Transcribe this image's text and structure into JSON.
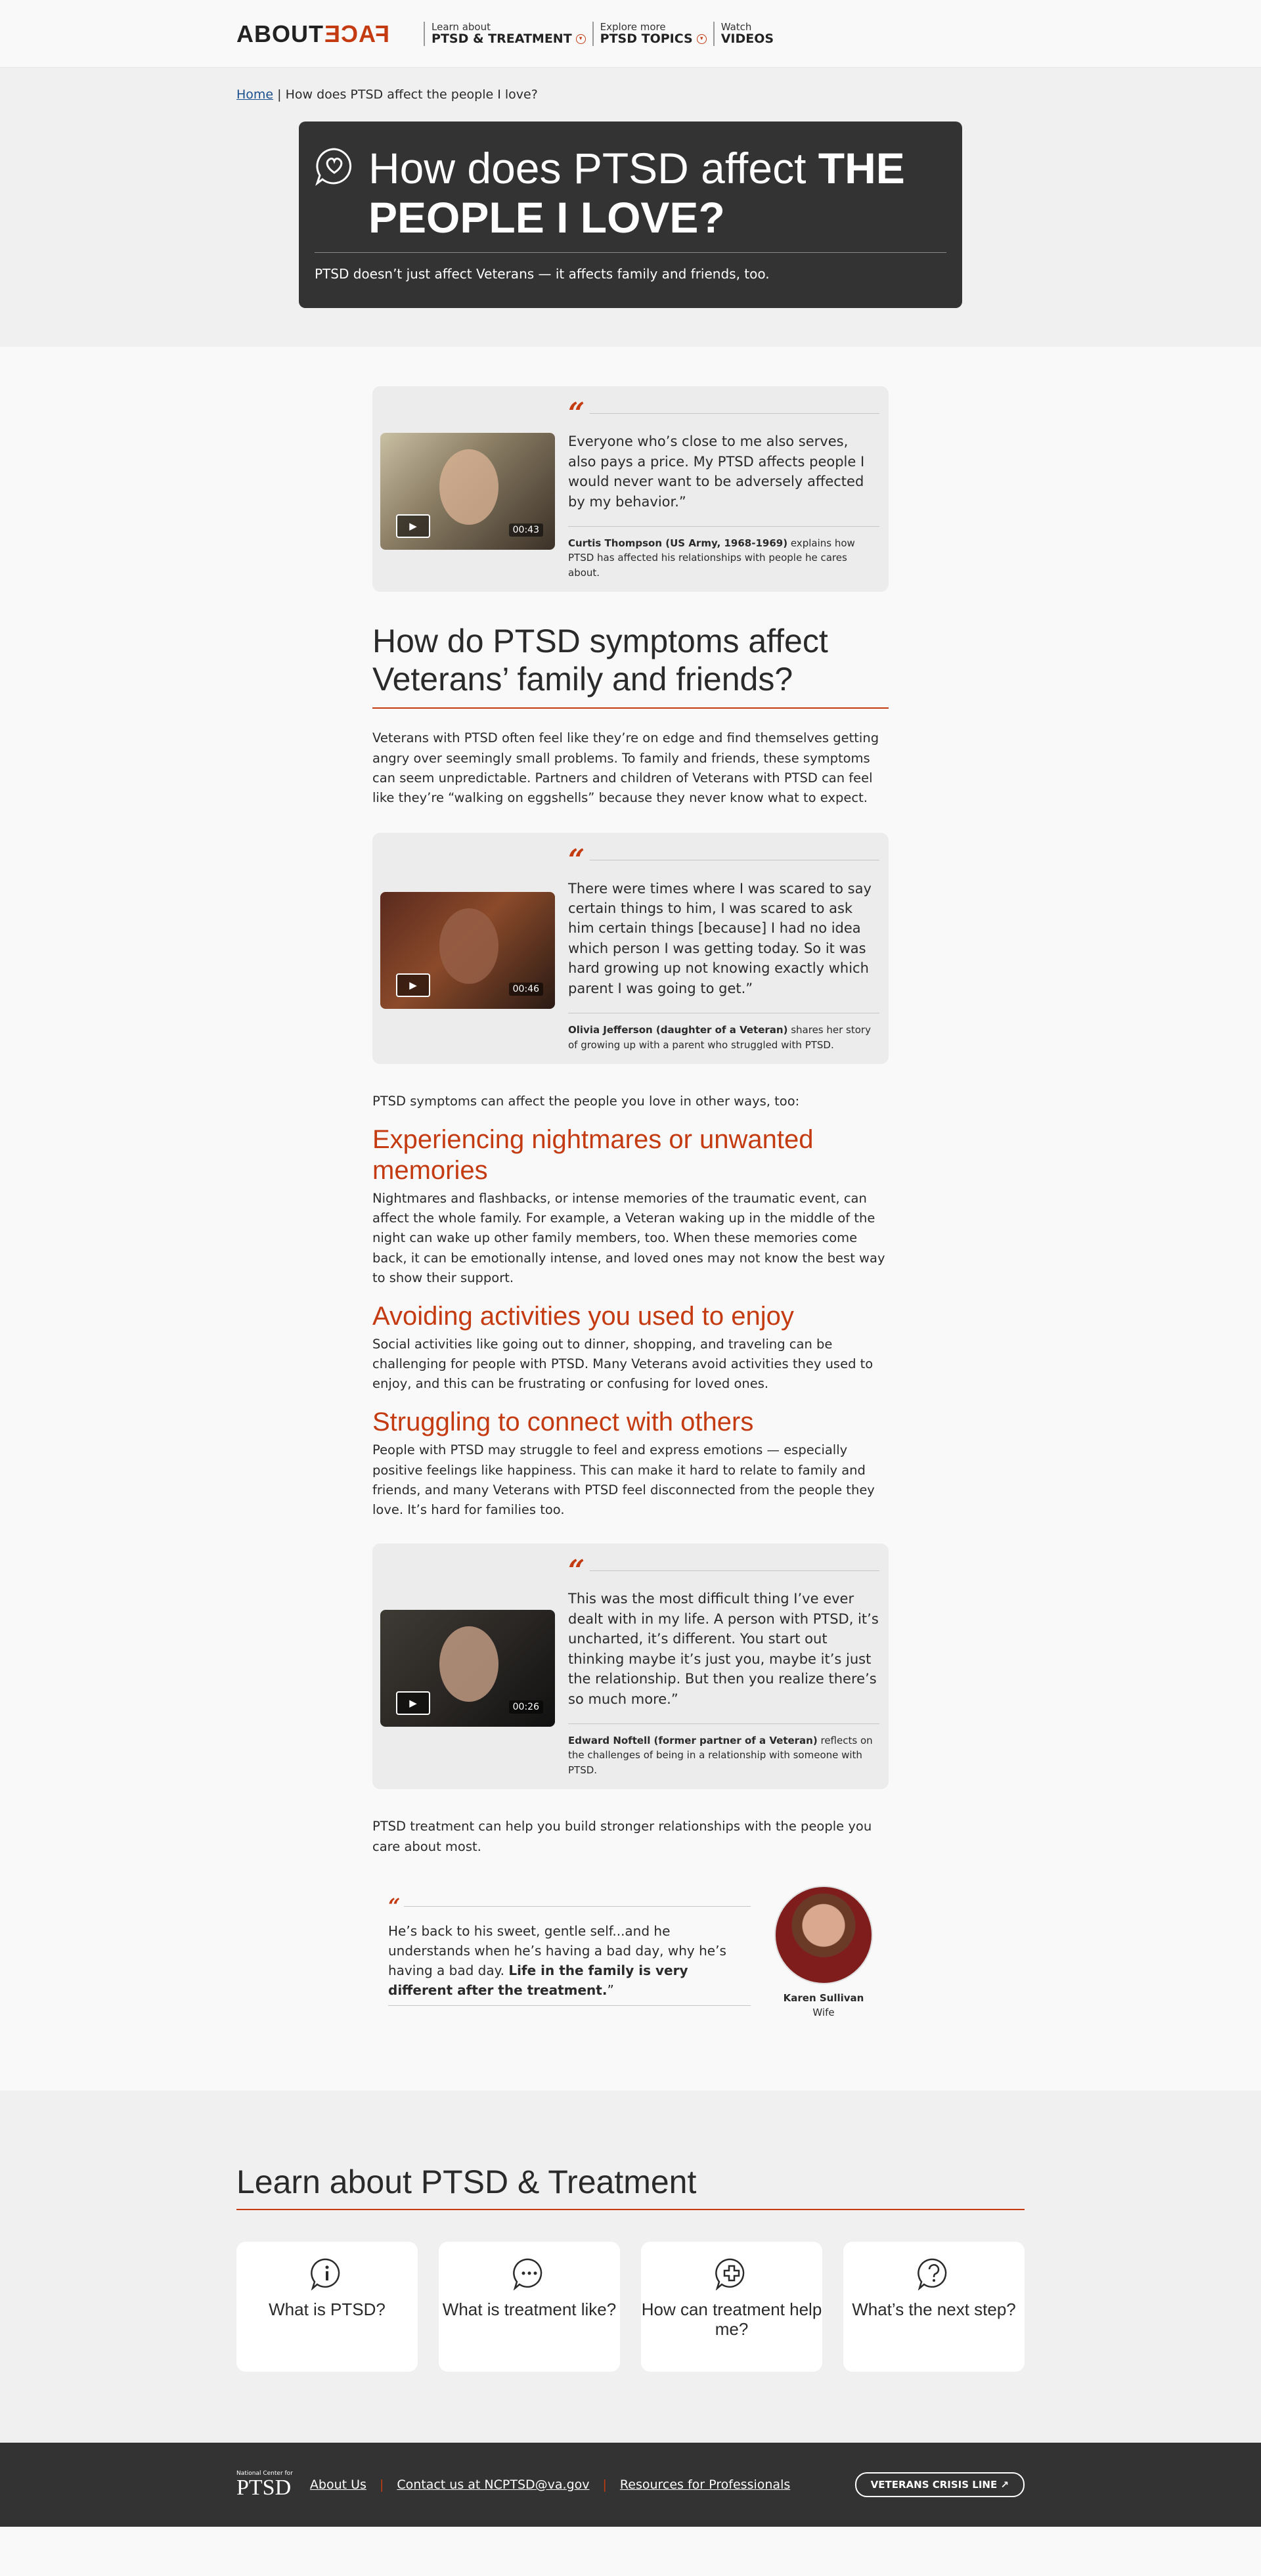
{
  "header": {
    "logo_about": "ABOUT",
    "logo_face": "FACE",
    "nav": [
      {
        "small": "Learn about",
        "big": "PTSD & TREATMENT",
        "has_dropdown": true
      },
      {
        "small": "Explore more",
        "big": "PTSD TOPICS",
        "has_dropdown": true
      },
      {
        "small": "Watch",
        "big": "VIDEOS",
        "has_dropdown": false
      }
    ]
  },
  "breadcrumb": {
    "home": "Home",
    "separator": "|",
    "current": "How does PTSD affect the people I love?"
  },
  "hero": {
    "title_light": "How does PTSD affect",
    "title_bold": "THE PEOPLE I LOVE?",
    "subtitle": "PTSD doesn’t just affect Veterans — it affects family and friends, too.",
    "icon": "speech-heart-icon"
  },
  "quotes": [
    {
      "duration": "00:43",
      "text": "Everyone who’s close to me also serves, also pays a price. My PTSD affects people I would never want to be adversely affected by my behavior.”",
      "attr_name": "Curtis Thompson (US Army, 1968-1969)",
      "attr_desc": " explains how PTSD has affected his relationships with people he cares about."
    },
    {
      "duration": "00:46",
      "text": "There were times where I was scared to say certain things to him, I was scared to ask him certain things [because] I had no idea which person I was getting today. So it was hard growing up not knowing exactly which parent I was going to get.”",
      "attr_name": "Olivia Jefferson (daughter of a Veteran)",
      "attr_desc": " shares her story of growing up with a parent who struggled with PTSD."
    },
    {
      "duration": "00:26",
      "text": "This was the most difficult thing I’ve ever dealt with in my life. A person with PTSD, it’s uncharted, it’s different. You start out thinking maybe it’s just you, maybe it’s just the relationship. But then you realize there’s so much more.”",
      "attr_name": "Edward Noftell (former partner of a Veteran)",
      "attr_desc": " reflects on the challenges of being in a relationship with someone with PTSD."
    }
  ],
  "section": {
    "heading": "How do PTSD symptoms affect Veterans’ family and friends?",
    "intro": "Veterans with PTSD often feel like they’re on edge and find themselves getting angry over seemingly small problems. To family and friends, these symptoms can seem unpredictable. Partners and children of Veterans with PTSD can feel like they’re “walking on eggshells” because they never know what to expect.",
    "lead": "PTSD symptoms can affect the people you love in other ways, too:",
    "subsections": [
      {
        "title": "Experiencing nightmares or unwanted memories",
        "body": "Nightmares and flashbacks, or intense memories of the traumatic event, can affect the whole family. For example, a Veteran waking up in the middle of the night can wake up other family members, too. When these memories come back, it can be emotionally intense, and loved ones may not know the best way to show their support."
      },
      {
        "title": "Avoiding activities you used to enjoy",
        "body": "Social activities like going out to dinner, shopping, and traveling can be challenging for people with PTSD. Many Veterans avoid activities they used to enjoy, and this can be frustrating or confusing for loved ones."
      },
      {
        "title": "Struggling to connect with others",
        "body": "People with PTSD may struggle to feel and express emotions — especially positive feelings like happiness. This can make it hard to relate to family and friends, and many Veterans with PTSD feel disconnected from the people they love. It’s hard for families too."
      }
    ],
    "closing": "PTSD treatment can help you build stronger relationships with the people you care about most."
  },
  "testimonial": {
    "text_plain": "He’s back to his sweet, gentle self...and he understands when he’s having a bad day, why he’s having a bad day. ",
    "text_bold": "Life in the family is very different after the treatment.",
    "text_end": "”",
    "name": "Karen Sullivan",
    "role": "Wife"
  },
  "learn": {
    "heading": "Learn about PTSD & Treatment",
    "cards": [
      {
        "label": "What is PTSD?",
        "icon": "info-bubble-icon"
      },
      {
        "label": "What is treatment like?",
        "icon": "ellipsis-bubble-icon"
      },
      {
        "label": "How can treatment help me?",
        "icon": "plus-bubble-icon"
      },
      {
        "label": "What’s the next step?",
        "icon": "question-bubble-icon"
      }
    ]
  },
  "footer": {
    "logo_small": "National Center for",
    "logo_big": "PTSD",
    "links": [
      "About Us",
      "Contact us at NCPTSD@va.gov",
      "Resources for Professionals"
    ],
    "crisis": "VETERANS CRISIS LINE ↗"
  },
  "colors": {
    "accent": "#c43b12",
    "dark": "#333333",
    "band": "#f0f0f0",
    "card": "#ececec"
  }
}
